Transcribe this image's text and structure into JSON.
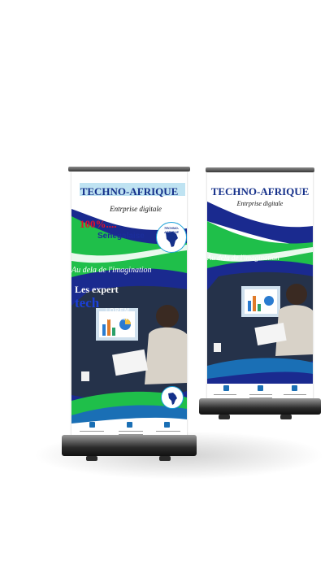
{
  "banners": [
    {
      "title": "TECHNO-AFRIQUE",
      "subtitle": "Entrprise digitale",
      "percent": "100%....",
      "country": "Senegalaise",
      "slogan": "Au dela de l'imagination",
      "experts": "Les expert",
      "tech": "tech",
      "lorem_line1": "LOREM",
      "lorem_line2": "IPSUM",
      "logo_text": "TECHNO-AFRIQUE"
    },
    {
      "title": "TECHNO-AFRIQUE",
      "subtitle": "Entrprise digitale",
      "slogan": "Au dela de l'imagination"
    }
  ],
  "colors": {
    "navy": "#15308a",
    "green": "#1fbf4a",
    "red": "#e0122a",
    "blue": "#1a3fd8",
    "contact_icon": "#1a6fb5"
  },
  "icons": [
    "mail-icon",
    "phone-icon",
    "globe-icon",
    "africa-map-icon"
  ]
}
